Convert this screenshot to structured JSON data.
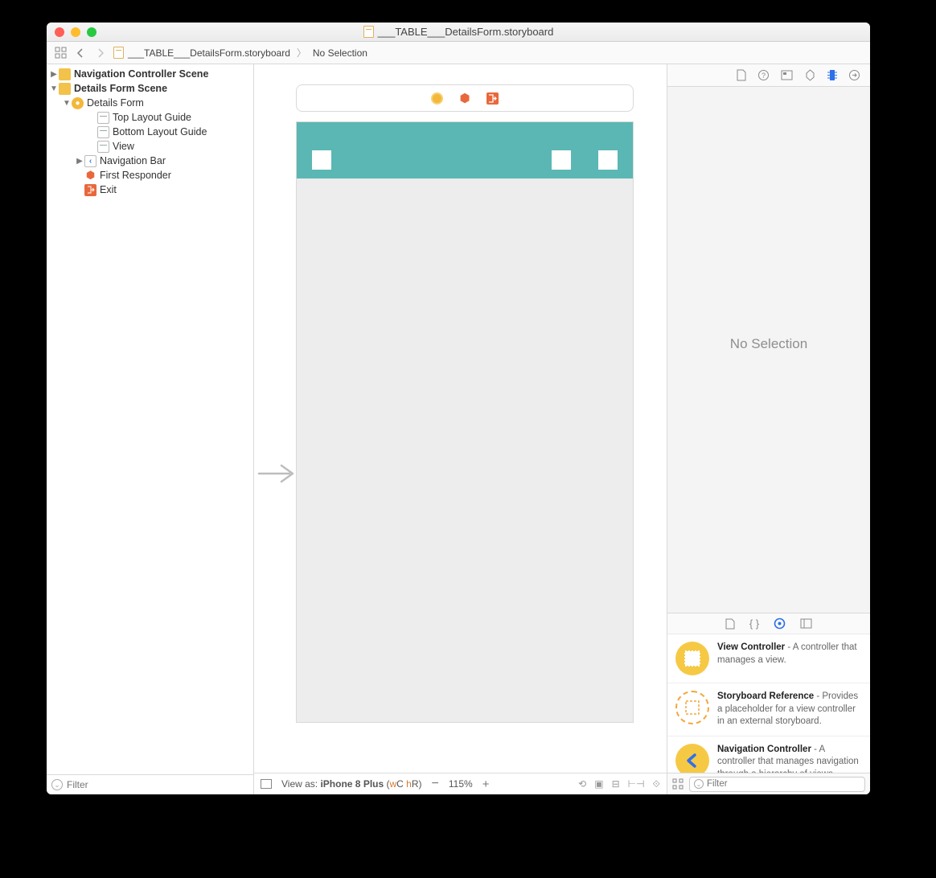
{
  "window": {
    "title": "___TABLE___DetailsForm.storyboard"
  },
  "breadcrumb": {
    "file": "___TABLE___DetailsForm.storyboard",
    "selection": "No Selection"
  },
  "outline": {
    "nodes": [
      {
        "label": "Navigation Controller Scene",
        "indent": 0,
        "disc": "▶",
        "icon": "folder",
        "bold": true
      },
      {
        "label": "Details Form Scene",
        "indent": 0,
        "disc": "▼",
        "icon": "folder",
        "bold": true
      },
      {
        "label": "Details Form",
        "indent": 1,
        "disc": "▼",
        "icon": "vc"
      },
      {
        "label": "Top Layout Guide",
        "indent": 3,
        "disc": "",
        "icon": "guide"
      },
      {
        "label": "Bottom Layout Guide",
        "indent": 3,
        "disc": "",
        "icon": "guide"
      },
      {
        "label": "View",
        "indent": 3,
        "disc": "",
        "icon": "guide"
      },
      {
        "label": "Navigation Bar",
        "indent": 2,
        "disc": "▶",
        "icon": "nav"
      },
      {
        "label": "First Responder",
        "indent": 2,
        "disc": "",
        "icon": "cube"
      },
      {
        "label": "Exit",
        "indent": 2,
        "disc": "",
        "icon": "exit"
      }
    ],
    "filter_placeholder": "Filter"
  },
  "canvas": {
    "view_as_prefix": "View as: ",
    "view_as_device": "iPhone 8 Plus ",
    "view_as_paren_open": "(",
    "view_as_w": "w",
    "view_as_C": "C ",
    "view_as_h": "h",
    "view_as_R": "R",
    "view_as_paren_close": ")",
    "zoom": "115%",
    "navbar_color": "#5bb7b3"
  },
  "inspector": {
    "no_selection": "No Selection"
  },
  "library": {
    "items": [
      {
        "title": "View Controller",
        "desc": " - A controller that manages a view.",
        "icon": "vc"
      },
      {
        "title": "Storyboard Reference",
        "desc": " - Provides a placeholder for a view controller in an external storyboard.",
        "icon": "dash"
      },
      {
        "title": "Navigation Controller",
        "desc": " - A controller that manages navigation through a hierarchy of views.",
        "icon": "nav"
      }
    ],
    "filter_placeholder": "Filter"
  }
}
